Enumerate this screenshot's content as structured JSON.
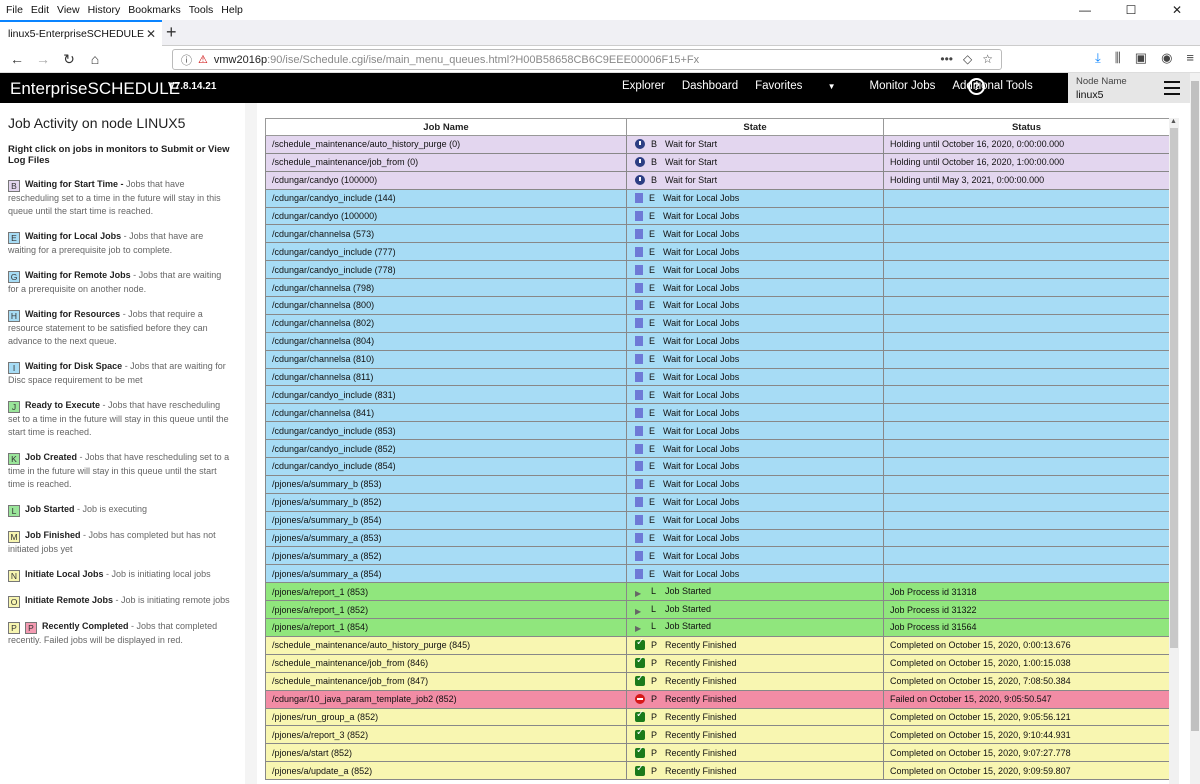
{
  "browser": {
    "menu": [
      "File",
      "Edit",
      "View",
      "History",
      "Bookmarks",
      "Tools",
      "Help"
    ],
    "tab_title": "linux5-EnterpriseSCHEDULE",
    "url_host": "vmw2016p",
    "url_rest": ":90/ise/Schedule.cgi/ise/main_menu_queues.html?H00B58658CB6C9EEE00006F15+Fx"
  },
  "app": {
    "brand": "EnterpriseSCHEDULE",
    "version": "V7.8.14.21",
    "nav": {
      "explorer": "Explorer",
      "dashboard": "Dashboard",
      "favorites": "Favorites",
      "monitor_jobs": "Monitor Jobs",
      "additional_tools": "Additional Tools"
    },
    "node_label": "Node Name",
    "node_value": "linux5"
  },
  "sidebar": {
    "title": "Job Activity on node LINUX5",
    "hint": "Right click on jobs in monitors to Submit or View Log Files",
    "legend": [
      {
        "code": "B",
        "label": "Waiting for Start Time -",
        "desc": " Jobs that have rescheduling set to a time in the future will stay in this queue until the start time is reached.",
        "color": "purple"
      },
      {
        "code": "E",
        "label": "Waiting for Local Jobs",
        "desc": " - Jobs that have are waiting for a prerequisite job to complete.",
        "color": "blue"
      },
      {
        "code": "G",
        "label": "Waiting for Remote Jobs",
        "desc": " - Jobs that are waiting for a prerequisite on another node.",
        "color": "blue"
      },
      {
        "code": "H",
        "label": "Waiting for Resources",
        "desc": " - Jobs that require a resource statement to be satisfied before they can advance to the next queue.",
        "color": "blue"
      },
      {
        "code": "I",
        "label": "Waiting for Disk Space",
        "desc": " - Jobs that are waiting for Disc space requirement to be met",
        "color": "blue"
      },
      {
        "code": "J",
        "label": "Ready to Execute",
        "desc": " - Jobs that have rescheduling set to a time in the future will stay in this queue until the start time is reached.",
        "color": "green"
      },
      {
        "code": "K",
        "label": "Job Created",
        "desc": " - Jobs that have rescheduling set to a time in the future will stay in this queue until the start time is reached.",
        "color": "green"
      },
      {
        "code": "L",
        "label": "Job Started",
        "desc": " - Job is executing",
        "color": "green"
      },
      {
        "code": "M",
        "label": "Job Finished",
        "desc": " - Jobs has completed but has not initiated jobs yet",
        "color": "yellow"
      },
      {
        "code": "N",
        "label": "Initiate Local Jobs",
        "desc": " - Job is initiating local jobs",
        "color": "yellow"
      },
      {
        "code": "O",
        "label": "Initiate Remote Jobs",
        "desc": " - Job is initiating remote jobs",
        "color": "yellow"
      },
      {
        "code": "P",
        "code2": "P",
        "label": "Recently Completed",
        "desc": " - Jobs that completed recently. Failed jobs will be displayed in red.",
        "color": "yellow"
      }
    ]
  },
  "table": {
    "headers": [
      "Job Name",
      "State",
      "Status"
    ],
    "rows": [
      {
        "name": "/schedule_maintenance/auto_history_purge (0)",
        "icon": "clock",
        "code": "B",
        "state": "Wait for Start",
        "status": "Holding until October 16, 2020, 0:00:00.000",
        "color": "purple"
      },
      {
        "name": "/schedule_maintenance/job_from (0)",
        "icon": "clock",
        "code": "B",
        "state": "Wait for Start",
        "status": "Holding until October 16, 2020, 1:00:00.000",
        "color": "purple"
      },
      {
        "name": "/cdungar/candyo (100000)",
        "icon": "clock",
        "code": "B",
        "state": "Wait for Start",
        "status": "Holding until May 3, 2021, 0:00:00.000",
        "color": "purple"
      },
      {
        "name": "/cdungar/candyo_include (144)",
        "icon": "doc",
        "code": "E",
        "state": "Wait for Local Jobs",
        "status": "",
        "color": "blue"
      },
      {
        "name": "/cdungar/candyo (100000)",
        "icon": "doc",
        "code": "E",
        "state": "Wait for Local Jobs",
        "status": "",
        "color": "blue"
      },
      {
        "name": "/cdungar/channelsa (573)",
        "icon": "doc",
        "code": "E",
        "state": "Wait for Local Jobs",
        "status": "",
        "color": "blue"
      },
      {
        "name": "/cdungar/candyo_include (777)",
        "icon": "doc",
        "code": "E",
        "state": "Wait for Local Jobs",
        "status": "",
        "color": "blue"
      },
      {
        "name": "/cdungar/candyo_include (778)",
        "icon": "doc",
        "code": "E",
        "state": "Wait for Local Jobs",
        "status": "",
        "color": "blue"
      },
      {
        "name": "/cdungar/channelsa (798)",
        "icon": "doc",
        "code": "E",
        "state": "Wait for Local Jobs",
        "status": "",
        "color": "blue"
      },
      {
        "name": "/cdungar/channelsa (800)",
        "icon": "doc",
        "code": "E",
        "state": "Wait for Local Jobs",
        "status": "",
        "color": "blue"
      },
      {
        "name": "/cdungar/channelsa (802)",
        "icon": "doc",
        "code": "E",
        "state": "Wait for Local Jobs",
        "status": "",
        "color": "blue"
      },
      {
        "name": "/cdungar/channelsa (804)",
        "icon": "doc",
        "code": "E",
        "state": "Wait for Local Jobs",
        "status": "",
        "color": "blue"
      },
      {
        "name": "/cdungar/channelsa (810)",
        "icon": "doc",
        "code": "E",
        "state": "Wait for Local Jobs",
        "status": "",
        "color": "blue"
      },
      {
        "name": "/cdungar/channelsa (811)",
        "icon": "doc",
        "code": "E",
        "state": "Wait for Local Jobs",
        "status": "",
        "color": "blue"
      },
      {
        "name": "/cdungar/candyo_include (831)",
        "icon": "doc",
        "code": "E",
        "state": "Wait for Local Jobs",
        "status": "",
        "color": "blue"
      },
      {
        "name": "/cdungar/channelsa (841)",
        "icon": "doc",
        "code": "E",
        "state": "Wait for Local Jobs",
        "status": "",
        "color": "blue"
      },
      {
        "name": "/cdungar/candyo_include (853)",
        "icon": "doc",
        "code": "E",
        "state": "Wait for Local Jobs",
        "status": "",
        "color": "blue"
      },
      {
        "name": "/cdungar/candyo_include (852)",
        "icon": "doc",
        "code": "E",
        "state": "Wait for Local Jobs",
        "status": "",
        "color": "blue"
      },
      {
        "name": "/cdungar/candyo_include (854)",
        "icon": "doc",
        "code": "E",
        "state": "Wait for Local Jobs",
        "status": "",
        "color": "blue"
      },
      {
        "name": "/pjones/a/summary_b (853)",
        "icon": "doc",
        "code": "E",
        "state": "Wait for Local Jobs",
        "status": "",
        "color": "blue"
      },
      {
        "name": "/pjones/a/summary_b (852)",
        "icon": "doc",
        "code": "E",
        "state": "Wait for Local Jobs",
        "status": "",
        "color": "blue"
      },
      {
        "name": "/pjones/a/summary_b (854)",
        "icon": "doc",
        "code": "E",
        "state": "Wait for Local Jobs",
        "status": "",
        "color": "blue"
      },
      {
        "name": "/pjones/a/summary_a (853)",
        "icon": "doc",
        "code": "E",
        "state": "Wait for Local Jobs",
        "status": "",
        "color": "blue"
      },
      {
        "name": "/pjones/a/summary_a (852)",
        "icon": "doc",
        "code": "E",
        "state": "Wait for Local Jobs",
        "status": "",
        "color": "blue"
      },
      {
        "name": "/pjones/a/summary_a (854)",
        "icon": "doc",
        "code": "E",
        "state": "Wait for Local Jobs",
        "status": "",
        "color": "blue"
      },
      {
        "name": "/pjones/a/report_1 (853)",
        "icon": "play",
        "code": "L",
        "state": "Job Started",
        "status": "Job Process id 31318",
        "color": "green"
      },
      {
        "name": "/pjones/a/report_1 (852)",
        "icon": "play",
        "code": "L",
        "state": "Job Started",
        "status": "Job Process id 31322",
        "color": "green"
      },
      {
        "name": "/pjones/a/report_1 (854)",
        "icon": "play",
        "code": "L",
        "state": "Job Started",
        "status": "Job Process id 31564",
        "color": "green"
      },
      {
        "name": "/schedule_maintenance/auto_history_purge (845)",
        "icon": "check",
        "code": "P",
        "state": "Recently Finished",
        "status": "Completed on October 15, 2020, 0:00:13.676",
        "color": "yellow"
      },
      {
        "name": "/schedule_maintenance/job_from (846)",
        "icon": "check",
        "code": "P",
        "state": "Recently Finished",
        "status": "Completed on October 15, 2020, 1:00:15.038",
        "color": "yellow"
      },
      {
        "name": "/schedule_maintenance/job_from (847)",
        "icon": "check",
        "code": "P",
        "state": "Recently Finished",
        "status": "Completed on October 15, 2020, 7:08:50.384",
        "color": "yellow"
      },
      {
        "name": "/cdungar/10_java_param_template_job2 (852)",
        "icon": "stop",
        "code": "P",
        "state": "Recently Finished",
        "status": "Failed on October 15, 2020, 9:05:50.547",
        "color": "red"
      },
      {
        "name": "/pjones/run_group_a (852)",
        "icon": "check",
        "code": "P",
        "state": "Recently Finished",
        "status": "Completed on October 15, 2020, 9:05:56.121",
        "color": "yellow"
      },
      {
        "name": "/pjones/a/report_3 (852)",
        "icon": "check",
        "code": "P",
        "state": "Recently Finished",
        "status": "Completed on October 15, 2020, 9:10:44.931",
        "color": "yellow"
      },
      {
        "name": "/pjones/a/start (852)",
        "icon": "check",
        "code": "P",
        "state": "Recently Finished",
        "status": "Completed on October 15, 2020, 9:07:27.778",
        "color": "yellow"
      },
      {
        "name": "/pjones/a/update_a (852)",
        "icon": "check",
        "code": "P",
        "state": "Recently Finished",
        "status": "Completed on October 15, 2020, 9:09:59.807",
        "color": "yellow"
      }
    ]
  }
}
